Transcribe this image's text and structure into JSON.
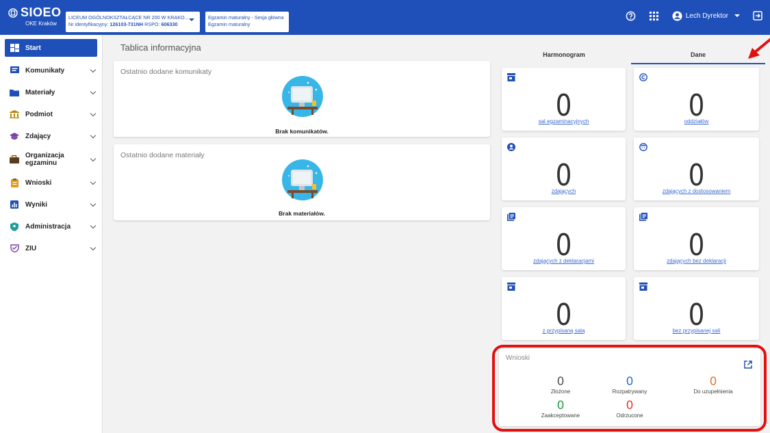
{
  "header": {
    "brand_title": "SIOEO",
    "brand_sub": "OKE Kraków",
    "school_line1": "LICEUM OGÓLNOKSZTAŁCĄCE NR 200 W KRAKO...",
    "school_id_label": "Nr identyfikacyjny:",
    "school_id": "126103-731NH",
    "rspo_label": "RSPO:",
    "rspo": "606330",
    "exam_line1": "Egzamin maturalny - Sesja główna",
    "exam_line2": "Egzamin maturalny",
    "user_name": "Lech Dyrektor"
  },
  "sidebar": {
    "items": [
      {
        "label": "Start"
      },
      {
        "label": "Komunikaty"
      },
      {
        "label": "Materiały"
      },
      {
        "label": "Podmiot"
      },
      {
        "label": "Zdający"
      },
      {
        "label": "Organizacja egzaminu"
      },
      {
        "label": "Wnioski"
      },
      {
        "label": "Wyniki"
      },
      {
        "label": "Administracja"
      },
      {
        "label": "ZIU"
      }
    ]
  },
  "main": {
    "title": "Tablica informacyjna",
    "cards": [
      {
        "title": "Ostatnio dodane komunikaty",
        "empty": "Brak komunikatów."
      },
      {
        "title": "Ostatnio dodane materiały",
        "empty": "Brak materiałów."
      }
    ]
  },
  "panel": {
    "tabs": [
      {
        "label": "Harmonogram"
      },
      {
        "label": "Dane"
      }
    ],
    "stats": [
      {
        "value": "0",
        "label": "sal egzaminacyjnych",
        "icon": "store-icon"
      },
      {
        "value": "0",
        "label": "oddziałów",
        "icon": "copyright-icon"
      },
      {
        "value": "0",
        "label": "zdających",
        "icon": "account-circle-icon"
      },
      {
        "value": "0",
        "label": "zdających z dostosowaniem",
        "icon": "face-icon"
      },
      {
        "value": "0",
        "label": "zdających z deklaracjami",
        "icon": "library-books-icon"
      },
      {
        "value": "0",
        "label": "zdających bez deklaracji",
        "icon": "library-books-icon"
      },
      {
        "value": "0",
        "label": "z przypisaną salą",
        "icon": "store-icon"
      },
      {
        "value": "0",
        "label": "bez przypisanej sali",
        "icon": "store-icon"
      }
    ],
    "wnioski": {
      "title": "Wnioski",
      "items": [
        {
          "value": "0",
          "label": "Złożone",
          "color": "#555555"
        },
        {
          "value": "0",
          "label": "Rozpatrywany",
          "color": "#2f6fd6"
        },
        {
          "value": "0",
          "label": "Do uzupełnienia",
          "color": "#e0793a"
        },
        {
          "value": "0",
          "label": "Zaakceptowane",
          "color": "#2e9b4b"
        },
        {
          "value": "0",
          "label": "Odrzucone",
          "color": "#e23b3b"
        }
      ]
    }
  },
  "colors": {
    "primary": "#1f4fb8",
    "highlight": "#e31010"
  }
}
